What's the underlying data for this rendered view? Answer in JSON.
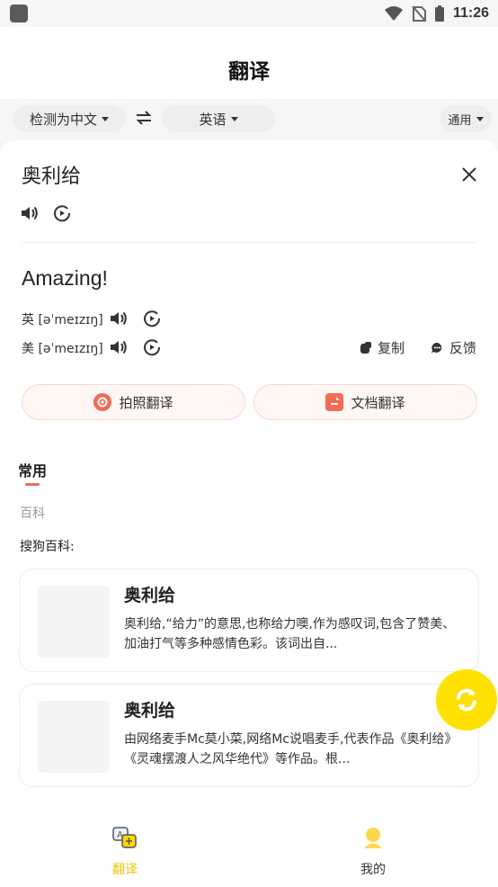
{
  "status_bar": {
    "time": "11:26"
  },
  "header": {
    "title": "翻译"
  },
  "lang_bar": {
    "source_lang": "检测为中文",
    "target_lang": "英语",
    "domain": "通用"
  },
  "translation": {
    "source_text": "奥利给",
    "result_text": "Amazing!",
    "uk_phonetic": "英 [əˈmeɪzɪŋ]",
    "us_phonetic": "美 [əˈmeɪzɪŋ]",
    "copy_label": "复制",
    "feedback_label": "反馈",
    "photo_translate_label": "拍照翻译",
    "doc_translate_label": "文档翻译"
  },
  "common": {
    "tab_label": "常用",
    "section_label": "百科",
    "source_label": "搜狗百科:",
    "entries": [
      {
        "title": "奥利给",
        "desc": "奥利给,“给力”的意思,也称给力噢,作为感叹词,包含了赞美、加油打气等多种感情色彩。该词出自..."
      },
      {
        "title": "奥利给",
        "desc": "由网络麦手Mc莫小菜,网络Mc说唱麦手,代表作品《奥利给》《灵魂摆渡人之风华绝代》等作品。根..."
      }
    ]
  },
  "bottom_nav": {
    "translate_label": "翻译",
    "mine_label": "我的"
  },
  "colors": {
    "accent": "#ffd600",
    "active_tab": "#f0c400",
    "brand_red": "#f46a52"
  }
}
